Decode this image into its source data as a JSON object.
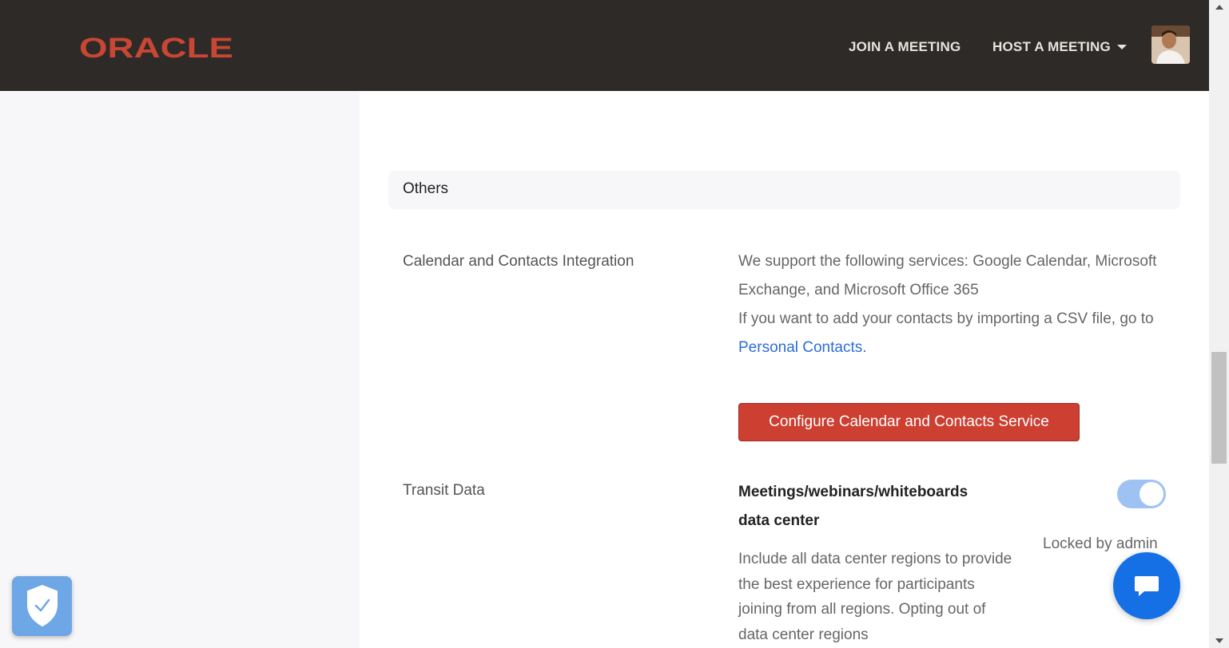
{
  "header": {
    "logo_text": "ORACLE",
    "nav": {
      "join_label": "JOIN A MEETING",
      "host_label": "HOST A MEETING"
    },
    "brand_color": "#c74634"
  },
  "section": {
    "title": "Others"
  },
  "calendar": {
    "label": "Calendar and Contacts Integration",
    "desc_line1": "We support the following services: Google Calendar, Microsoft Exchange, and Microsoft Office 365",
    "desc_line2_prefix": "If you want to add your contacts by importing a CSV file, go to ",
    "desc_link": "Personal Contacts",
    "desc_line2_suffix": ".",
    "button_label": "Configure Calendar and Contacts Service"
  },
  "transit": {
    "label": "Transit Data",
    "title": "Meetings/webinars/whiteboards data center",
    "description": "Include all data center regions to provide the best experience for participants joining from all regions. Opting out of data center regions",
    "toggle_on": true,
    "locked_text": "Locked by admin"
  },
  "colors": {
    "button_red": "#cc3f31",
    "link_blue": "#2d6bdd",
    "toggle_on": "#9ec3f3",
    "chat_blue": "#1670e5"
  }
}
